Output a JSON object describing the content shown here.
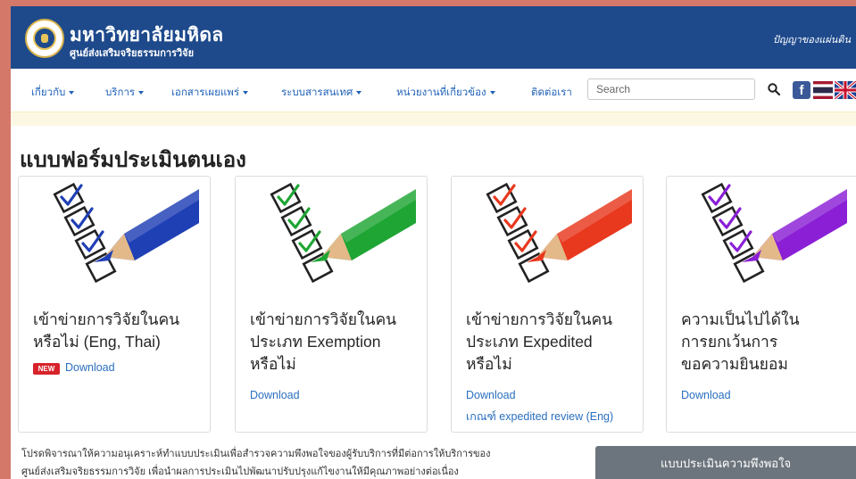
{
  "header": {
    "university_name": "มหาวิทยาลัยมหิดล",
    "center_name": "ศูนย์ส่งเสริมจริยธรรมการวิจัย",
    "motto": "ปัญญาของแผ่นดิน"
  },
  "nav": {
    "items": [
      {
        "label": "เกี่ยวกับ",
        "dropdown": true
      },
      {
        "label": "บริการ",
        "dropdown": true
      },
      {
        "label": "เอกสารเผยแพร่",
        "dropdown": true
      },
      {
        "label": "ระบบสารสนเทศ",
        "dropdown": true
      },
      {
        "label": "หน่วยงานที่เกี่ยวข้อง",
        "dropdown": true
      },
      {
        "label": "ติดต่อเรา",
        "dropdown": false
      }
    ],
    "search_placeholder": "Search",
    "icons": [
      "search-icon",
      "facebook-icon",
      "thai-flag-icon",
      "uk-flag-icon"
    ]
  },
  "page_title": "แบบฟอร์มประเมินตนเอง",
  "cards": [
    {
      "title": "เข้าข่ายการวิจัยในคน หรือไม่ (Eng, Thai)",
      "badge": "NEW",
      "download_label": "Download",
      "pencil_color": "#1f3fb5"
    },
    {
      "title": "เข้าข่ายการวิจัยในคน ประเภท Exemption หรือไม่",
      "download_label": "Download",
      "pencil_color": "#1ea534"
    },
    {
      "title": "เข้าข่ายการวิจัยในคน ประเภท Expedited หรือไม่",
      "download_label": "Download",
      "extra_link": "เกณฑ์ expedited review (Eng)",
      "pencil_color": "#e8381d"
    },
    {
      "title": "ความเป็นไปได้ใน การยกเว้นการ ขอความยินยอม",
      "download_label": "Download",
      "pencil_color": "#8a1fd6"
    }
  ],
  "bottom_text": {
    "line1": "โปรดพิจารณาให้ความอนุเคราะห์ทำแบบประเมินเพื่อสำรวจความพึงพอใจของผู้รับบริการที่มีต่อการให้บริการของ",
    "line2": "ศูนย์ส่งเสริมจริยธรรมการวิจัย เพื่อนำผลการประเมินไปพัฒนาปรับปรุงแก้ไขงานให้มีคุณภาพอย่างต่อเนื่อง"
  },
  "survey_button": "แบบประเมินความพึงพอใจ",
  "colors": {
    "brand": "#1e4a8c",
    "link": "#2163b8",
    "notice": "#fcf8e3",
    "button": "#6c757d"
  }
}
